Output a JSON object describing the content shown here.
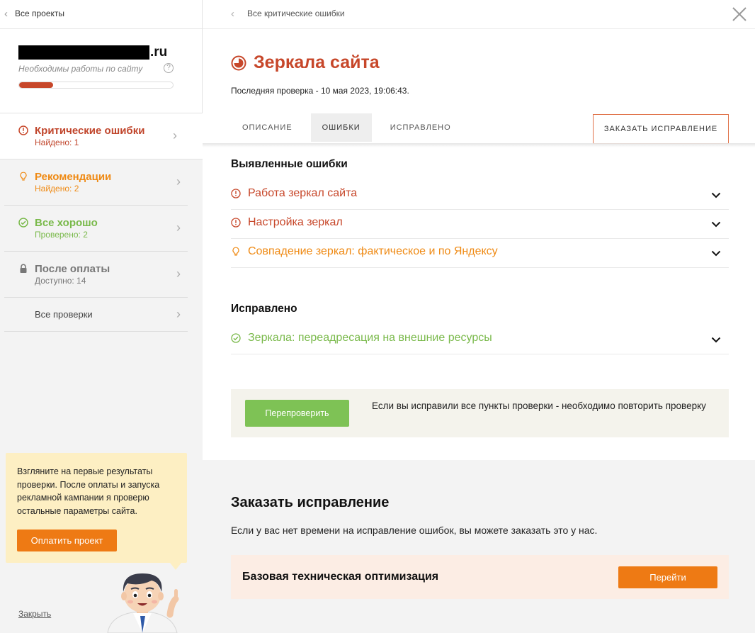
{
  "sidebar": {
    "back_label": "Все проекты",
    "domain_suffix": ".ru",
    "work_status": "Необходимы работы по сайту",
    "help_symbol": "?",
    "progress_fraction": 0.22,
    "items": [
      {
        "title": "Критические ошибки",
        "sub": "Найдено: 1"
      },
      {
        "title": "Рекомендации",
        "sub": "Найдено: 2"
      },
      {
        "title": "Все хорошо",
        "sub": "Проверено: 2"
      },
      {
        "title": "После оплаты",
        "sub": "Доступно: 14"
      },
      {
        "title": "Все проверки"
      }
    ],
    "promo_text": "Взгляните на первые результаты проверки. После оплаты и запуска рекламной кампании я проверю остальные параметры сайта.",
    "pay_button": "Оплатить проект",
    "close_link": "Закрыть"
  },
  "main": {
    "breadcrumb": "Все критические ошибки",
    "title": "Зеркала сайта",
    "last_check": "Последняя проверка - 10 мая 2023, 19:06:43.",
    "tabs": [
      "ОПИСАНИЕ",
      "ОШИБКИ",
      "ИСПРАВЛЕНО"
    ],
    "active_tab": "ОШИБКИ",
    "order_button": "ЗАКАЗАТЬ ИСПРАВЛЕНИЕ",
    "found_heading": "Выявленные ошибки",
    "found_items": [
      "Работа зеркал сайта",
      "Настройка зеркал",
      "Совпадение зеркал: фактическое и по Яндексу"
    ],
    "fixed_heading": "Исправлено",
    "fixed_items": [
      "Зеркала: переадресация на внешние ресурсы"
    ],
    "recheck_button": "Перепроверить",
    "recheck_text": "Если вы исправили все пункты проверки - необходимо повторить проверку",
    "order_title": "Заказать исправление",
    "order_text": "Если у вас нет времени на исправление ошибок, вы можете заказать это у нас.",
    "offer_name": "Базовая техническая оптимизация",
    "go_button": "Перейти"
  },
  "colors": {
    "critical": "#c7472a",
    "recommendation": "#ef8a14",
    "ok": "#79b94a",
    "action_orange": "#ee7a14",
    "recheck_green": "#7ec255"
  },
  "icons": {
    "critical": "exclamation-circle-icon",
    "recommendation": "lightbulb-icon",
    "ok": "check-circle-icon",
    "locked": "lock-icon",
    "expand": "chevron-down-icon",
    "close": "close-icon"
  }
}
